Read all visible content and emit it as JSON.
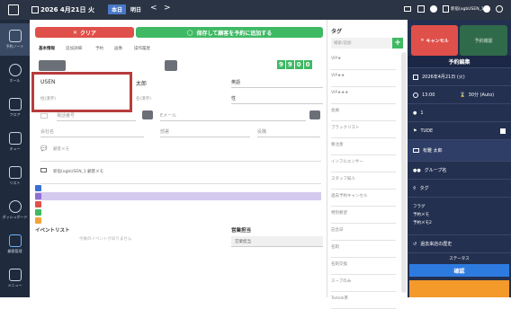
{
  "topbar": {
    "date": "2026 4月21日 火",
    "today": "本日",
    "tomorrow": "明日",
    "prev": "<",
    "next": ">",
    "user": "新宿(ogbUSEN_1"
  },
  "sidebar": [
    {
      "label": "予約ノート",
      "active": true
    },
    {
      "label": "ホール"
    },
    {
      "label": "フロア"
    },
    {
      "label": "キュー"
    },
    {
      "label": "リスト"
    },
    {
      "label": "ダッシュボード"
    },
    {
      "label": "顧客管理"
    },
    {
      "label": "メニュー"
    }
  ],
  "main": {
    "clear_label": "クリア",
    "save_label": "保存して顧客を予約に追加する",
    "tabs": [
      "基本情報",
      "追加詳細",
      "予約",
      "画像",
      "操作履歴"
    ],
    "counter": [
      "9",
      "9",
      "0",
      "0"
    ],
    "last_name": "USEN",
    "first_name": "太郎",
    "last_name_label": "姓(漢字)",
    "first_name_label": "名(漢字)",
    "lang_value": "英語",
    "gender_value": "性",
    "phone_placeholder": "電話番号",
    "email_placeholder": "Eメール",
    "company_placeholder": "会社名",
    "dept_placeholder": "部署",
    "title_placeholder": "役職",
    "memo_placeholder": "顧客メモ",
    "staff_memo": "新宿(ogbUSEN_1 顧客メモ",
    "events_title": "イベントリスト",
    "events_empty": "今後のイベントがありません",
    "sales_title": "営業担当",
    "sales_value": "営業担当"
  },
  "tags": {
    "title": "タグ",
    "search_placeholder": "検索/追加",
    "items": [
      "VIP★",
      "VIP★★",
      "VIP★★★",
      "会員",
      "ブラックリスト",
      "要注意",
      "インフルエンサー",
      "スタッフ知人",
      "過去予約キャンセル",
      "特別要望",
      "記念日",
      "名刺",
      "名刺交換",
      "スープのみ",
      "Tomok茶",
      "常連客"
    ]
  },
  "right": {
    "cancel_label": "キャンセル",
    "confirm_label": "予約確認",
    "title": "予約編集",
    "date": "2026年4月21日 (火)",
    "time": "13:00",
    "duration": "30分 (Auto)",
    "guests": "1",
    "seat": "TUDE",
    "name": "有難 太郎",
    "group": "グループ名",
    "tag": "タグ",
    "memo_lines": [
      "フラグ",
      "予約メモ",
      "予約メモ2"
    ],
    "history": "過去来店の歴史",
    "footer_label": "ステータス",
    "ok_label": "確認"
  }
}
